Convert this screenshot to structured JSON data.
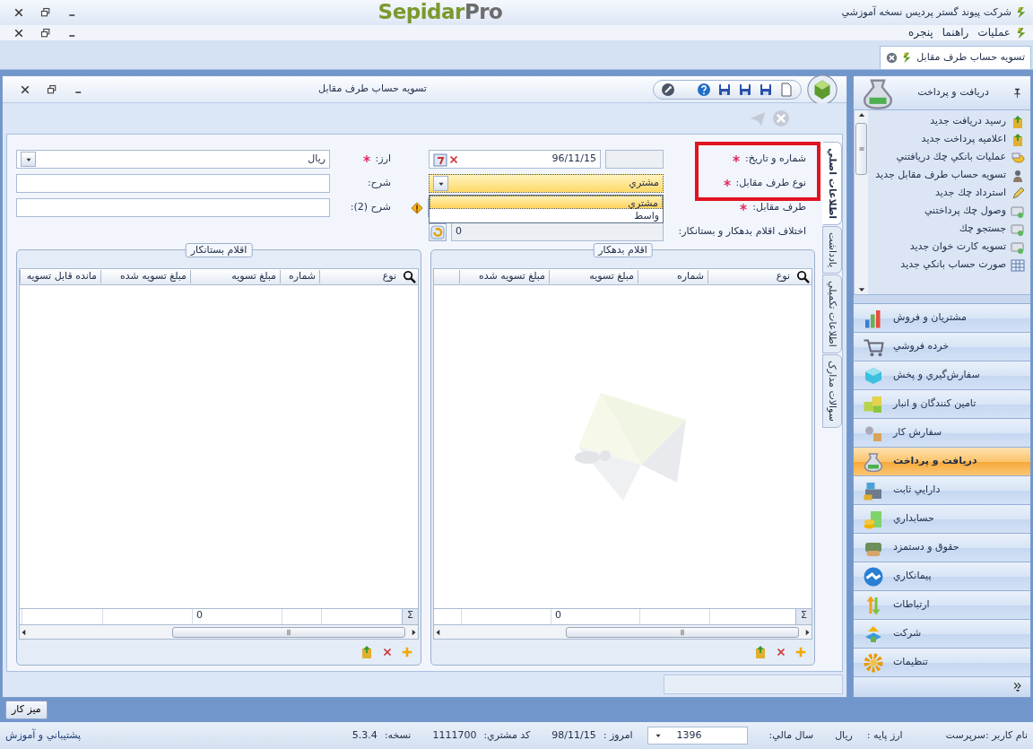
{
  "window": {
    "title": "شرکت پیوند گستر پردیس نسخه آموزشي",
    "logo": {
      "name": "Sepidar",
      "suffix": "Pro"
    }
  },
  "menu": [
    "عملیات",
    "راهنما",
    "پنجره"
  ],
  "doc_tabs": [
    {
      "label": "تسویه حساب طرف مقابل",
      "selected": true
    }
  ],
  "form": {
    "title": "تسویه حساب طرف مقابل",
    "side_tabs": [
      {
        "label": "اطلاعات اصلي",
        "selected": true
      },
      {
        "label": "يادداشت",
        "selected": false
      },
      {
        "label": "اطلاعات تکمیلي",
        "selected": false
      },
      {
        "label": "سوالات مدارک",
        "selected": false
      }
    ],
    "right_fields": [
      {
        "kind": "number_date",
        "label": "شماره و تاریخ:",
        "required": true,
        "highlighted": true,
        "value": "96/11/15"
      },
      {
        "kind": "combo",
        "label": "نوع طرف مقابل:",
        "required": true,
        "highlighted": true,
        "value": "مشتري",
        "open": true,
        "options": [
          {
            "label": "مشتري",
            "selected": true
          },
          {
            "label": "واسط",
            "selected": false
          }
        ]
      },
      {
        "kind": "lookup",
        "label": "طرف مقابل:",
        "required": true,
        "highlighted": false,
        "warning": true
      },
      {
        "kind": "readonly",
        "label": "اختلاف اقلام بدهکار و بستانکار:",
        "required": false,
        "highlighted": false,
        "value": "0"
      }
    ],
    "left_fields": [
      {
        "kind": "combo",
        "label": "ارز:",
        "required": true,
        "value": "ریال",
        "open": false
      },
      {
        "kind": "text",
        "label": "شرح:",
        "required": false
      },
      {
        "kind": "text",
        "label": "شرح (2):",
        "required": false
      }
    ],
    "grids": [
      {
        "title": "اقلام بدهکار",
        "columns": [
          "نوع",
          "شماره",
          "مبلغ تسویه",
          "مبلغ تسویه شده"
        ],
        "totals_symbol": "Σ",
        "totals": [
          {
            "kind": "blank"
          },
          {
            "kind": "blank"
          },
          {
            "kind": "value",
            "value": "0"
          },
          {
            "kind": "blank"
          }
        ]
      },
      {
        "title": "اقلام بستانکار",
        "columns": [
          "نوع",
          "شماره",
          "مبلغ تسویه",
          "مبلغ تسویه شده",
          "مانده قابل تسویه"
        ],
        "totals_symbol": "Σ",
        "totals": [
          {
            "kind": "blank"
          },
          {
            "kind": "blank"
          },
          {
            "kind": "value",
            "value": "0"
          },
          {
            "kind": "blank"
          },
          {
            "kind": "blank"
          }
        ]
      }
    ]
  },
  "nav": {
    "title": "دریافت و پرداخت",
    "tasks": [
      "رسید دریافت جدید",
      "اعلامیه پرداخت جدید",
      "عملیات بانکي چك دریافتني",
      "تسویه حساب طرف مقابل جدید",
      "استرداد چك جدید",
      "وصول چك پرداختني",
      "جستجو چك",
      "تسویه کارت خوان جدید",
      "صورت حساب بانکي جدید"
    ],
    "groups": [
      {
        "label": "مشتریان و فروش",
        "selected": false
      },
      {
        "label": "خرده فروشي",
        "selected": false
      },
      {
        "label": "سفارش‌گیري و پخش",
        "selected": false
      },
      {
        "label": "تامین کنندگان و انبار",
        "selected": false
      },
      {
        "label": "سفارش کار",
        "selected": false
      },
      {
        "label": "دریافت و پرداخت",
        "selected": true
      },
      {
        "label": "دارایي ثابت",
        "selected": false
      },
      {
        "label": "حسابداري",
        "selected": false
      },
      {
        "label": "حقوق و دستمزد",
        "selected": false
      },
      {
        "label": "پیمانکاري",
        "selected": false
      },
      {
        "label": "ارتباطات",
        "selected": false
      },
      {
        "label": "شرکت",
        "selected": false
      },
      {
        "label": "تنظیمات",
        "selected": false
      }
    ]
  },
  "taskbar": [
    "میز کار"
  ],
  "status": {
    "user": "نام کاربر :سرپرست",
    "base_currency_label": "ارز پایه :",
    "base_currency": "ریال",
    "fiscal_year_label": "سال مالي:",
    "fiscal_year": "1396",
    "today_label": "امروز :",
    "today": "98/11/15",
    "customer_code_label": "کد مشتري:",
    "customer_code": "1111700",
    "version_label": "نسخه:",
    "version": "5.3.4",
    "support_link": "پشتیباني و آموزش"
  }
}
